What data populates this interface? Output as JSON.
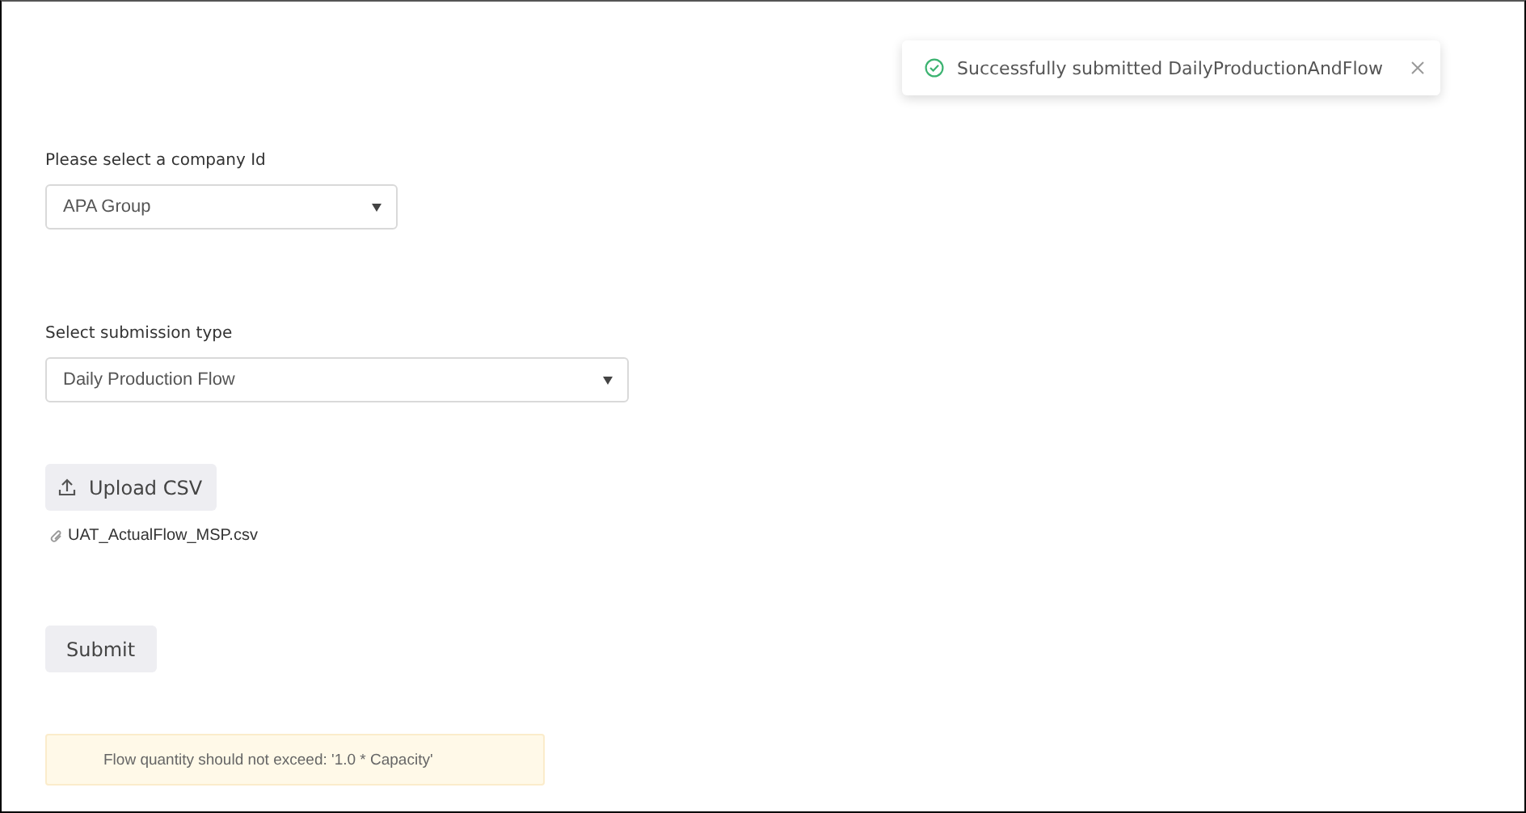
{
  "toast": {
    "message": "Successfully submitted DailyProductionAndFlow"
  },
  "fields": [
    {
      "label": "Please select a company Id",
      "value": "APA Group"
    },
    {
      "label": "Select submission type",
      "value": "Daily Production Flow"
    }
  ],
  "upload_button": {
    "label": "Upload CSV"
  },
  "file": {
    "name": "UAT_ActualFlow_MSP.csv"
  },
  "submit_button": {
    "label": "Submit"
  },
  "alert": {
    "message": "Flow quantity should not exceed: '1.0 * Capacity'"
  }
}
